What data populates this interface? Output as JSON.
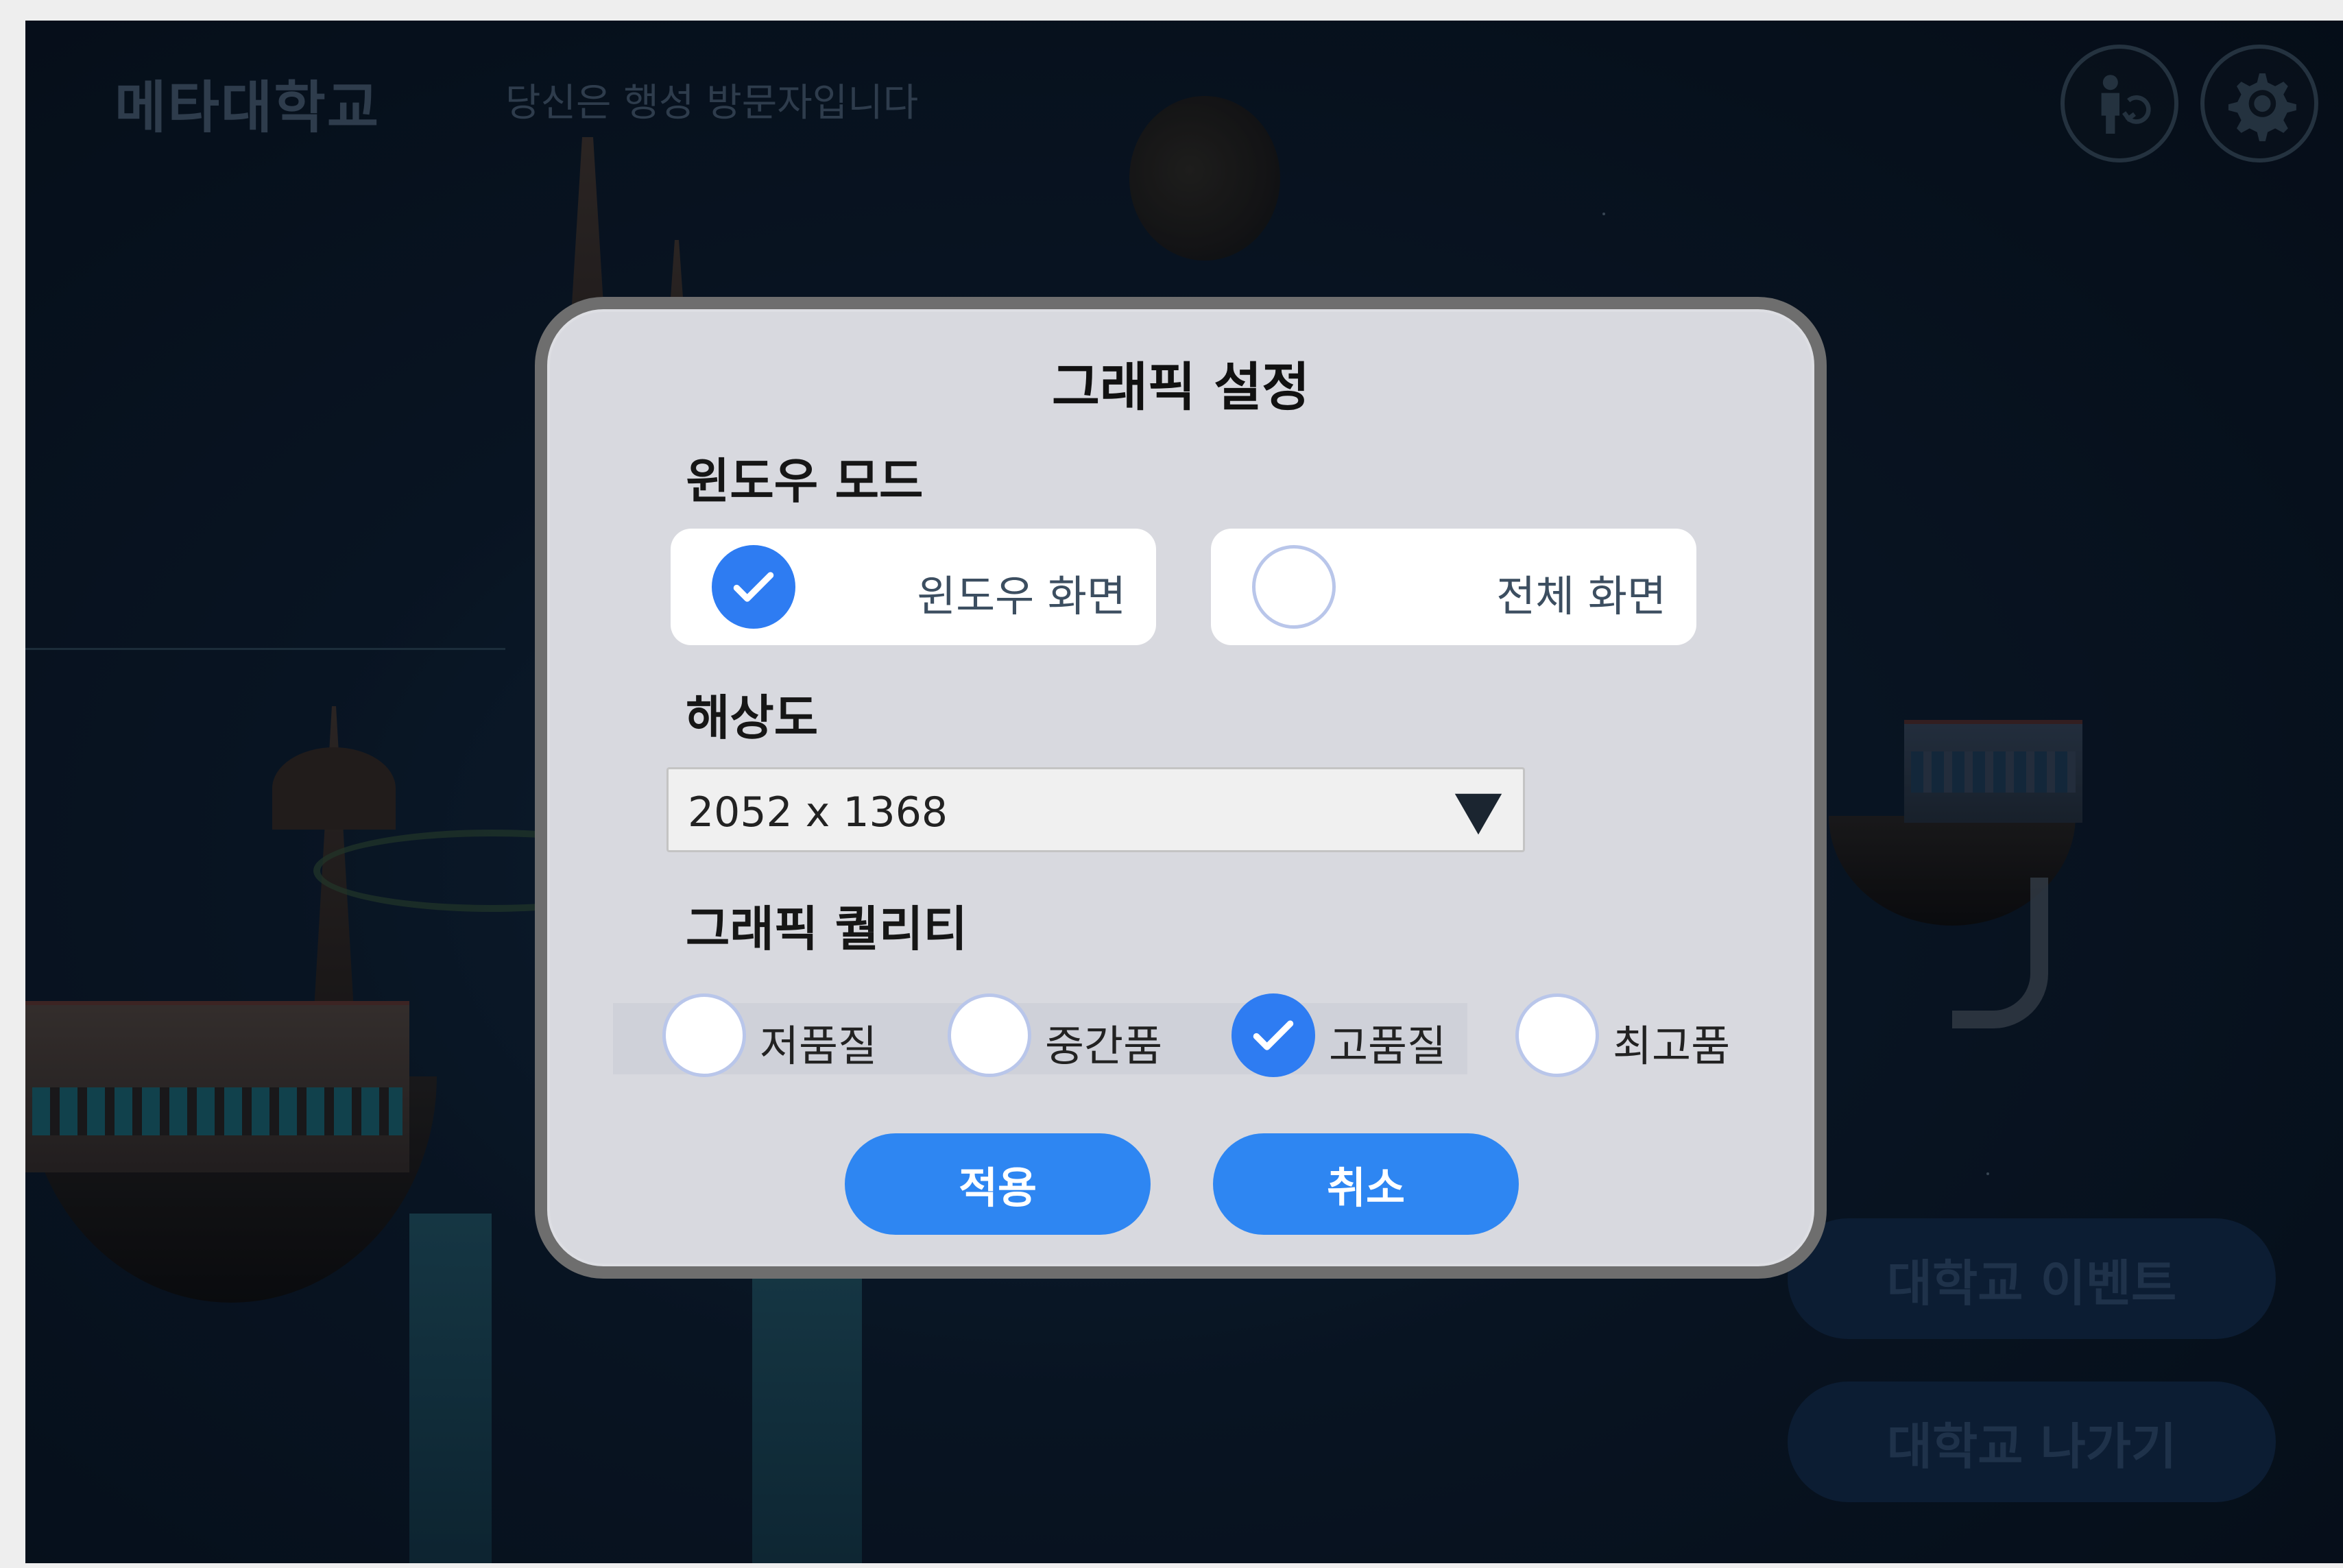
{
  "app": {
    "title": "메타대학교",
    "status": "당신은 행성 방문자입니다"
  },
  "top_icons": [
    {
      "name": "avatar-switch-icon"
    },
    {
      "name": "gear-icon"
    }
  ],
  "side_buttons": {
    "event": "대학교 이벤트",
    "exit": "대학교 나가기"
  },
  "dialog": {
    "title": "그래픽 설정",
    "window_mode": {
      "label": "윈도우 모드",
      "options": [
        {
          "label": "윈도우 화면",
          "selected": true
        },
        {
          "label": "전체 화면",
          "selected": false
        }
      ]
    },
    "resolution": {
      "label": "해상도",
      "selected": "2052 x 1368"
    },
    "quality": {
      "label": "그래픽 퀄리티",
      "options": [
        {
          "label": "저품질",
          "selected": false
        },
        {
          "label": "중간품",
          "selected": false
        },
        {
          "label": "고품질",
          "selected": true
        },
        {
          "label": "최고품",
          "selected": false
        }
      ]
    },
    "apply_label": "적용",
    "cancel_label": "취소"
  },
  "colors": {
    "accent": "#2e86f2",
    "dialog_bg": "#d8d9df",
    "dialog_border": "#6e6e6e"
  }
}
